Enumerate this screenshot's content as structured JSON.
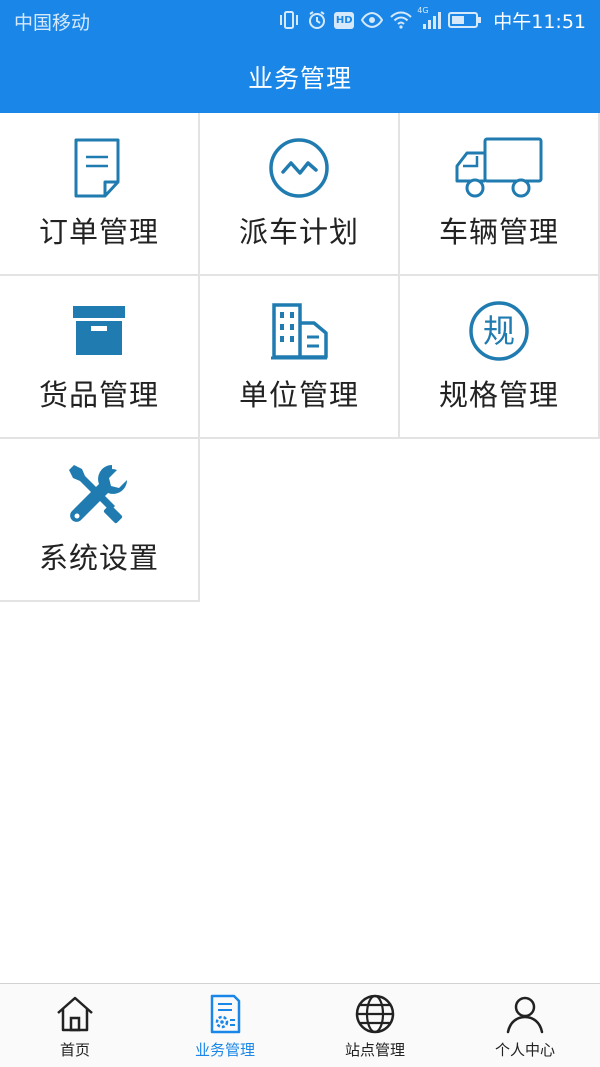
{
  "status_bar": {
    "carrier": "中国移动",
    "network": "4G",
    "hd_badge": "HD",
    "time": "中午11:51"
  },
  "header": {
    "title": "业务管理"
  },
  "modules": [
    {
      "label": "订单管理",
      "icon": "document-icon"
    },
    {
      "label": "派车计划",
      "icon": "wave-circle-icon"
    },
    {
      "label": "车辆管理",
      "icon": "truck-icon"
    },
    {
      "label": "货品管理",
      "icon": "box-icon"
    },
    {
      "label": "单位管理",
      "icon": "building-icon"
    },
    {
      "label": "规格管理",
      "icon": "spec-circle-icon",
      "icon_glyph": "规"
    },
    {
      "label": "系统设置",
      "icon": "tools-icon"
    }
  ],
  "colors": {
    "primary": "#1a87e8",
    "icon_teal": "#1f7bb0",
    "grid_border": "#e3e3e3"
  },
  "bottom_nav": {
    "active_index": 1,
    "items": [
      {
        "label": "首页",
        "icon": "home-icon"
      },
      {
        "label": "业务管理",
        "icon": "business-doc-icon"
      },
      {
        "label": "站点管理",
        "icon": "globe-icon"
      },
      {
        "label": "个人中心",
        "icon": "person-icon"
      }
    ]
  }
}
